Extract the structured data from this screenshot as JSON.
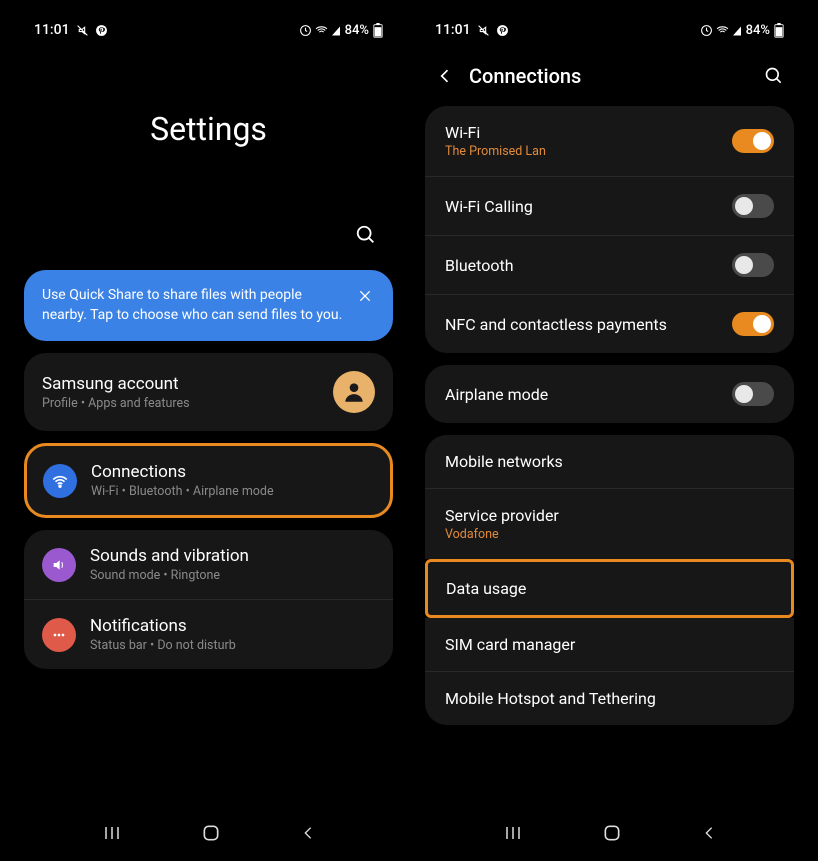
{
  "status": {
    "time": "11:01",
    "battery": "84%"
  },
  "screen1": {
    "title": "Settings",
    "tip": "Use Quick Share to share files with people nearby. Tap to choose who can send files to you.",
    "account": {
      "title": "Samsung account",
      "sub": "Profile  •  Apps and features"
    },
    "connections": {
      "title": "Connections",
      "sub": "Wi-Fi  •  Bluetooth  •  Airplane mode"
    },
    "sounds": {
      "title": "Sounds and vibration",
      "sub": "Sound mode  •  Ringtone"
    },
    "notifications": {
      "title": "Notifications",
      "sub": "Status bar  •  Do not disturb"
    }
  },
  "screen2": {
    "header": "Connections",
    "wifi": {
      "title": "Wi-Fi",
      "sub": "The Promised Lan",
      "on": true
    },
    "wifi_calling": {
      "title": "Wi-Fi Calling",
      "on": false
    },
    "bluetooth": {
      "title": "Bluetooth",
      "on": false
    },
    "nfc": {
      "title": "NFC and contactless payments",
      "on": true
    },
    "airplane": {
      "title": "Airplane mode",
      "on": false
    },
    "mobile_networks": {
      "title": "Mobile networks"
    },
    "service_provider": {
      "title": "Service provider",
      "sub": "Vodafone"
    },
    "data_usage": {
      "title": "Data usage"
    },
    "sim": {
      "title": "SIM card manager"
    },
    "hotspot": {
      "title": "Mobile Hotspot and Tethering"
    }
  }
}
